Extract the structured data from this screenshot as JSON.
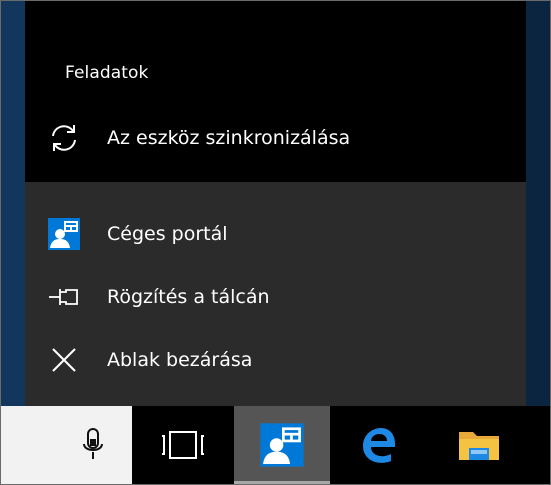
{
  "jumplist": {
    "tasks_heading": "Feladatok",
    "tasks": [
      {
        "label": "Az eszköz szinkronizálása",
        "icon": "sync-icon"
      }
    ],
    "items": [
      {
        "label": "Céges portál",
        "icon": "company-portal-icon"
      },
      {
        "label": "Rögzítés a tálcán",
        "icon": "pin-icon"
      },
      {
        "label": "Ablak bezárása",
        "icon": "close-icon"
      }
    ]
  },
  "taskbar": {
    "buttons": [
      {
        "icon": "microphone-icon"
      },
      {
        "icon": "task-view-icon"
      },
      {
        "icon": "company-portal-icon",
        "active": true
      },
      {
        "icon": "edge-icon"
      },
      {
        "icon": "file-explorer-icon"
      }
    ]
  },
  "colors": {
    "jumplist_bg": "#2b2b2b",
    "tasks_bg": "#000000",
    "portal_blue": "#0078d7",
    "edge_blue": "#1e88e5",
    "folder_yellow": "#f5c342",
    "active_taskbar_bg": "#555555"
  }
}
